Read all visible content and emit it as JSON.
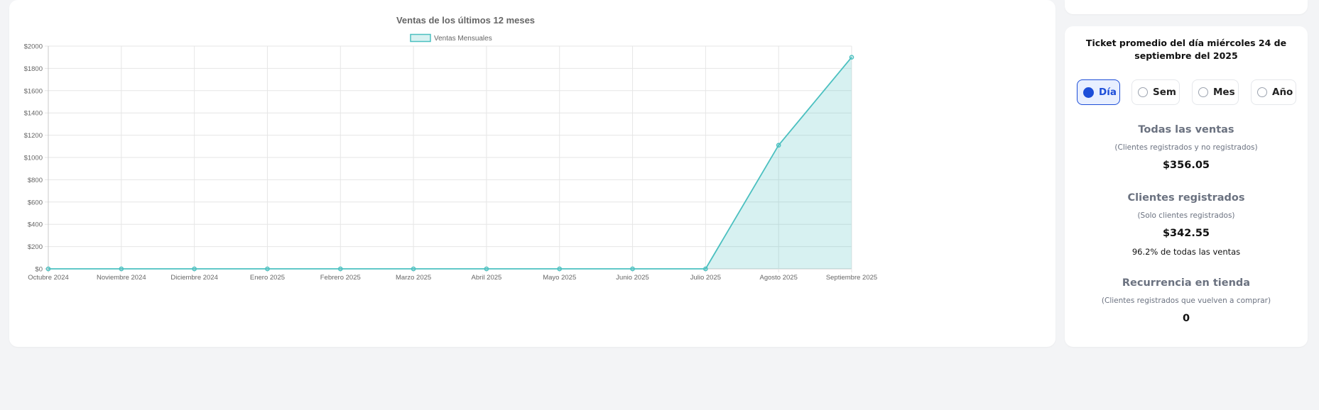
{
  "chart_data": {
    "type": "area",
    "title": "Ventas de los últimos 12 meses",
    "legend_position": "top",
    "grid": true,
    "categories": [
      "Octubre 2024",
      "Noviembre 2024",
      "Diciembre 2024",
      "Enero 2025",
      "Febrero 2025",
      "Marzo 2025",
      "Abril 2025",
      "Mayo 2025",
      "Junio 2025",
      "Julio 2025",
      "Agosto 2025",
      "Septiembre 2025"
    ],
    "series": [
      {
        "name": "Ventas Mensuales",
        "values": [
          0,
          0,
          0,
          0,
          0,
          0,
          0,
          0,
          0,
          0,
          1110,
          1900
        ],
        "color": "#4bc0c0",
        "fill": "rgba(75,192,192,0.22)"
      }
    ],
    "ylim": [
      0,
      2000
    ],
    "yticks": [
      0,
      200,
      400,
      600,
      800,
      1000,
      1200,
      1400,
      1600,
      1800,
      2000
    ],
    "ytick_labels": [
      "$0",
      "$200",
      "$400",
      "$600",
      "$800",
      "$1000",
      "$1200",
      "$1400",
      "$1600",
      "$1800",
      "$2000"
    ]
  },
  "ticket": {
    "title": "Ticket promedio del día miércoles 24 de septiembre del 2025",
    "periods": [
      {
        "label": "Día",
        "active": true
      },
      {
        "label": "Sem",
        "active": false
      },
      {
        "label": "Mes",
        "active": false
      },
      {
        "label": "Año",
        "active": false
      }
    ],
    "all_sales": {
      "title": "Todas las ventas",
      "subtitle": "(Clientes registrados y no registrados)",
      "value": "$356.05"
    },
    "registered": {
      "title": "Clientes registrados",
      "subtitle": "(Solo clientes registrados)",
      "value": "$342.55",
      "percent_text": "96.2% de todas las ventas"
    },
    "recurrence": {
      "title": "Recurrencia en tienda",
      "subtitle": "(Clientes registrados que vuelven a comprar)",
      "value": "0"
    }
  },
  "colors": {
    "accent": "#1d4ed8",
    "series": "#4bc0c0",
    "background": "#f3f4f6"
  }
}
